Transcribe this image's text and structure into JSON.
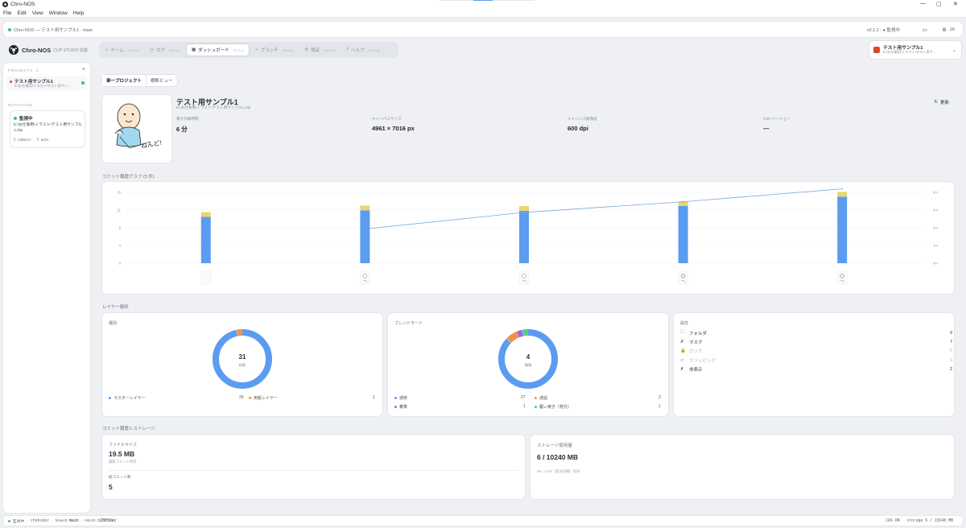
{
  "window": {
    "title": "Chro-NOS",
    "controls": [
      "—",
      "▢",
      "✕"
    ]
  },
  "menu": [
    "File",
    "Edit",
    "View",
    "Window",
    "Help"
  ],
  "topbar": {
    "breadcrumb": "Chro-NOS — テスト用サンプル1 · main",
    "version": "v0.1.2 · ● 監視中",
    "lang": "JA"
  },
  "header": {
    "app_name": "Chro-NOS",
    "subtitle": "CLIP STUDIO 授業",
    "tabs": [
      {
        "label": "ホーム",
        "shortcut": "Ctrl+1"
      },
      {
        "label": "ログ",
        "shortcut": "Ctrl+2"
      },
      {
        "label": "ダッシュボード",
        "shortcut": "Ctrl+3"
      },
      {
        "label": "ブランチ",
        "shortcut": "Ctrl+4"
      },
      {
        "label": "設定",
        "shortcut": "Ctrl+5"
      },
      {
        "label": "ヘルプ",
        "shortcut": "Ctrl+6"
      }
    ],
    "project_name": "テスト用サンプル1",
    "project_path": "E:\\お仕事用\\イラスト\\テスト用サ..."
  },
  "sidebar": {
    "projects_label": "PROJECTS",
    "projects_count": "1",
    "add_label": "+",
    "project_name": "テスト用サンプル1",
    "project_path": "E:\\お仕事用\\イラスト\\テスト用サン...",
    "watching_label": "WATCHING",
    "watch_status": "監視中",
    "watch_path": "E:\\お仕事用\\イラスト\\テスト用サンプル1.clip",
    "watch_stats": "5 commits   5 auto"
  },
  "dashboard": {
    "view_single": "単一プロジェクト",
    "view_compare": "横断ビュー",
    "title": "テスト用サンプル1",
    "path": "E:\\お仕事用\\イラスト\\テスト用サンプル1.clip",
    "refresh": "更新",
    "thumb_text": "ねんど!",
    "meta": [
      {
        "label": "累計作業時間",
        "value": "6 分"
      },
      {
        "label": "キャンバスサイズ",
        "value": "4961 × 7016 px"
      },
      {
        "label": "キャンバス解像度",
        "value": "600 dpi"
      },
      {
        "label": "CSP バージョン",
        "value": "—"
      }
    ]
  },
  "commit_graph": {
    "label": "コミット履歴グラフ (5 件)"
  },
  "chart_data": {
    "type": "bar",
    "categories": [
      "1",
      "2",
      "3",
      "4",
      "5"
    ],
    "y_ticks": [
      "0",
      "4",
      "8",
      "11",
      "15"
    ],
    "y2_ticks": [
      "0m",
      "1m",
      "3m",
      "4m",
      "6m"
    ],
    "ylim": [
      0,
      15
    ],
    "y2lim": [
      0,
      6
    ],
    "series": [
      {
        "values": [
          9.8,
          11.2,
          11.1,
          12.1,
          14.1
        ],
        "color": "#5b9cf0"
      },
      {
        "values": [
          1.0,
          1.0,
          1.0,
          1.0,
          1.0
        ],
        "color": "#ecd56a"
      },
      {
        "type": "line",
        "values": [
          null,
          2.9,
          4.3,
          5.2,
          6.3
        ],
        "color": "#7aa9e0"
      }
    ],
    "grid": true
  },
  "layers": {
    "section_label": "レイヤー解析",
    "type_card": {
      "title": "種別",
      "total": "31",
      "total_label": "総数",
      "segments": [
        {
          "name": "ラスターレイヤー",
          "count": 29,
          "display": "29",
          "color": "#5b9cf0"
        },
        {
          "name": "用紙レイヤー",
          "count": 1,
          "display": "1",
          "color": "#f0924a"
        }
      ],
      "extra_value": 1
    },
    "blend_card": {
      "title": "ブレンドモード",
      "total": "4",
      "total_label": "種類",
      "segments": [
        {
          "name": "通常",
          "count": 27,
          "display": "27",
          "color": "#5b9cf0"
        },
        {
          "name": "通過",
          "count": 2,
          "display": "2",
          "color": "#f0924a"
        },
        {
          "name": "乗算",
          "count": 1,
          "display": "1",
          "color": "#a366d6"
        },
        {
          "name": "覆い焼き（発光）",
          "count": 1,
          "display": "1",
          "color": "#4ccf86"
        }
      ]
    },
    "attr_card": {
      "title": "属性",
      "rows": [
        {
          "icon": "folder-icon",
          "glyph": "🗀",
          "label": "フォルダ",
          "count": "9",
          "dim": false
        },
        {
          "icon": "mask-icon",
          "glyph": "✗",
          "label": "マスク",
          "count": "7",
          "dim": false
        },
        {
          "icon": "lock-icon",
          "glyph": "🔒",
          "label": "ロック",
          "count": "0",
          "dim": true
        },
        {
          "icon": "clipping-icon",
          "glyph": "⇄",
          "label": "クリッピング",
          "count": "0",
          "dim": true
        },
        {
          "icon": "hidden-icon",
          "glyph": "✗",
          "label": "非表示",
          "count": "2",
          "dim": false
        }
      ]
    }
  },
  "storage": {
    "section_label": "コミット履歴とストレージ",
    "file_size_label": "ファイルサイズ",
    "file_size": "19.5 MB",
    "file_size_sub": "最新コミット時点",
    "commits_label": "総コミット数",
    "commits": "5",
    "usage_label": "ストレージ使用量",
    "usage": "6 / 10240 MB",
    "usage_sub": "3% · CAS（差分圧縮）有効"
  },
  "status": {
    "watching": "監視中",
    "watcher": "chokidar",
    "branch_label": "branch:",
    "branch": "main",
    "head_label": "HEAD:",
    "head": "c2003dec",
    "right": "CAS ON   storage 6 / 10240 MB"
  }
}
